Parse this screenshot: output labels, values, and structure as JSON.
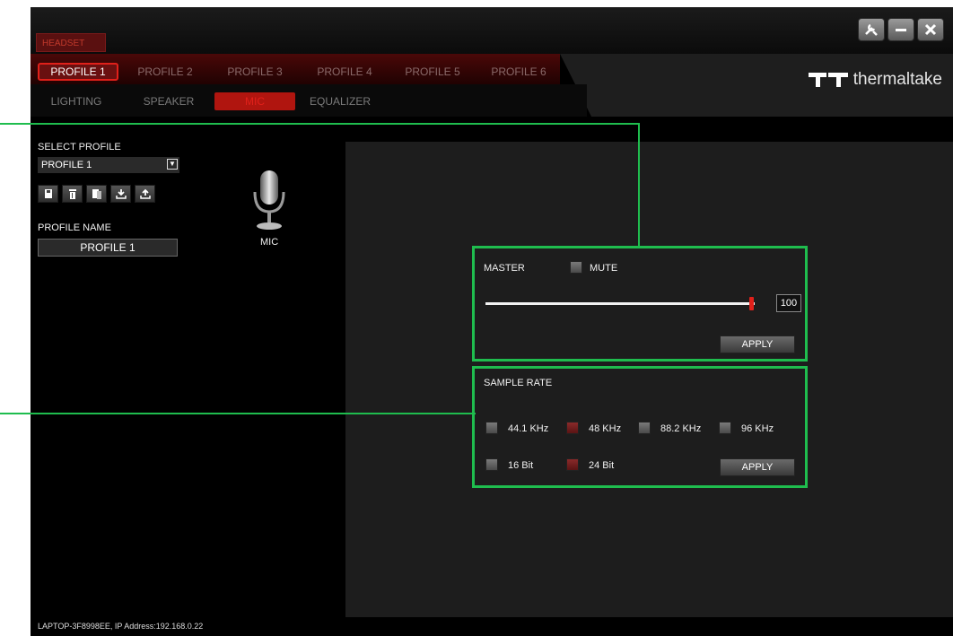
{
  "titlebar": {
    "device_tab": "HEADSET",
    "window_buttons": [
      {
        "name": "settings-wrench-icon",
        "glyph": "✕"
      },
      {
        "name": "minimize-icon",
        "glyph": "—"
      },
      {
        "name": "close-icon",
        "glyph": "✕"
      }
    ]
  },
  "profiles": {
    "tabs": [
      "PROFILE 1",
      "PROFILE 2",
      "PROFILE 3",
      "PROFILE 4",
      "PROFILE 5",
      "PROFILE 6"
    ],
    "active_index": 0
  },
  "brand": {
    "name": "thermaltake",
    "logo_icon": "tt-logo-icon"
  },
  "subtabs": {
    "items": [
      "LIGHTING",
      "SPEAKER",
      "MIC",
      "EQUALIZER"
    ],
    "active_index": 2
  },
  "sidebar": {
    "select_label": "SELECT PROFILE",
    "select_value": "PROFILE 1",
    "tool_icons": [
      "save-icon",
      "delete-icon",
      "copy-icon",
      "import-icon",
      "export-icon"
    ],
    "name_label": "PROFILE NAME",
    "name_value": "PROFILE 1",
    "mic_label": "MIC",
    "mic_icon": "microphone-icon"
  },
  "master": {
    "label": "MASTER",
    "mute_label": "MUTE",
    "mute_checked": false,
    "volume": "100",
    "apply_label": "APPLY"
  },
  "sample_rate": {
    "label": "SAMPLE RATE",
    "rates": [
      {
        "label": "44.1 KHz",
        "checked": false
      },
      {
        "label": "48 KHz",
        "checked": true
      },
      {
        "label": "88.2 KHz",
        "checked": false
      },
      {
        "label": "96 KHz",
        "checked": false
      }
    ],
    "bits": [
      {
        "label": "16 Bit",
        "checked": false
      },
      {
        "label": "24 Bit",
        "checked": true
      }
    ],
    "apply_label": "APPLY"
  },
  "footer": {
    "text": "LAPTOP-3F8998EE, IP Address:192.168.0.22"
  },
  "colors": {
    "accent_red": "#e0201a",
    "highlight_green": "#1fbd4e",
    "background": "#000000"
  }
}
